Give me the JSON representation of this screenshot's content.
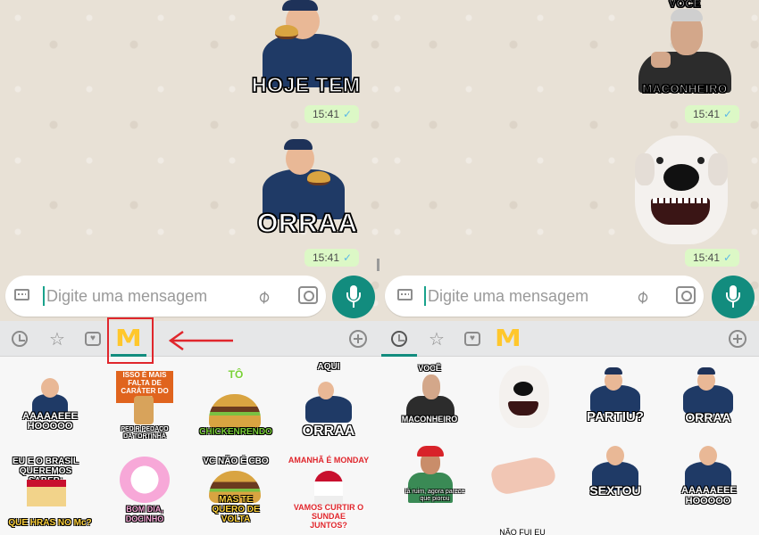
{
  "left_chat": {
    "stickers": [
      {
        "caption": "HOJE TEM",
        "time": "15:41"
      },
      {
        "caption": "ORRAA",
        "time": "15:41"
      }
    ]
  },
  "right_chat": {
    "stickers": [
      {
        "top_caption": "VOCÊ",
        "caption": "MACONHEIRO",
        "time": "15:41"
      },
      {
        "caption": "",
        "time": "15:41"
      }
    ]
  },
  "composer": {
    "placeholder": "Digite uma mensagem"
  },
  "sticker_tabs": {
    "recent": "clock-icon",
    "favorites": "star-icon",
    "emoji_pack": "heart-box-icon",
    "mcdonalds_pack": "M",
    "add": "plus-icon",
    "accent": "#128c7e"
  },
  "left_grid": {
    "stickers": [
      {
        "top": "",
        "label": "AAAAAEEE HOOOOO"
      },
      {
        "top": "ISSO É MAIS FALTA DE CARÁTER DO QUE",
        "label": "PEDIR PEDAÇO DA TORTINHA"
      },
      {
        "top": "TÔ",
        "label": "CHICKENRENDO"
      },
      {
        "top": "AQUI",
        "label": "ORRAA"
      },
      {
        "top": "EU E O BRASIL QUEREMOS SABER:",
        "label": "QUE HRAS NO Mc?"
      },
      {
        "top": "",
        "label": "BOM DIA, DOCINHO"
      },
      {
        "top": "VC NÃO É CBO",
        "label": "MAS TE QUERO DE VOLTA"
      },
      {
        "top": "AMANHÃ É MONDAY",
        "label": "VAMOS CURTIR O SUNDAE JUNTOS?"
      }
    ]
  },
  "right_grid": {
    "stickers": [
      {
        "top": "VOCÊ",
        "label": "MACONHEIRO"
      },
      {
        "top": "",
        "label": ""
      },
      {
        "top": "",
        "label": "PARTIU?"
      },
      {
        "top": "",
        "label": "ORRAA"
      },
      {
        "top": "",
        "label": "tá ruim, agora parece que piorou"
      },
      {
        "top": "",
        "label": ""
      },
      {
        "top": "",
        "label": "SEXTOU"
      },
      {
        "top": "",
        "label": "AAAAAEEE HOOOOO"
      }
    ],
    "bottom_partial": "NÃO FUI EU"
  }
}
